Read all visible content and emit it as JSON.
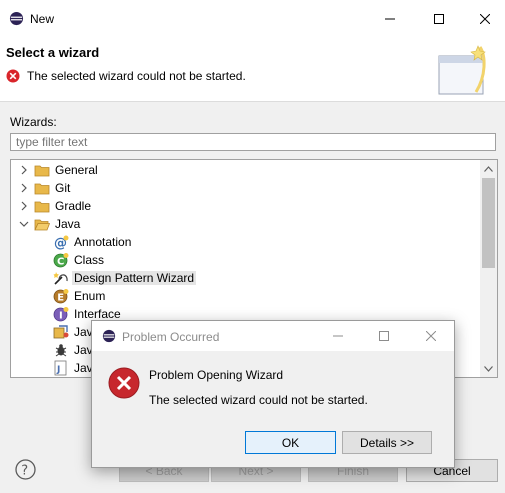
{
  "window": {
    "title": "New",
    "icon": "eclipse-icon"
  },
  "banner": {
    "heading": "Select a wizard",
    "message": "The selected wizard could not be started."
  },
  "wizards_label": "Wizards:",
  "filter": {
    "placeholder": "type filter text",
    "value": ""
  },
  "tree": [
    {
      "label": "General",
      "icon": "folder-icon",
      "expanded": false
    },
    {
      "label": "Git",
      "icon": "folder-icon",
      "expanded": false
    },
    {
      "label": "Gradle",
      "icon": "folder-icon",
      "expanded": false
    },
    {
      "label": "Java",
      "icon": "folder-open-icon",
      "expanded": true
    },
    {
      "label": "Annotation",
      "icon": "annotation-icon"
    },
    {
      "label": "Class",
      "icon": "class-icon"
    },
    {
      "label": "Design Pattern Wizard",
      "icon": "design-pattern-icon",
      "selected": true
    },
    {
      "label": "Enum",
      "icon": "enum-icon"
    },
    {
      "label": "Interface",
      "icon": "interface-icon"
    },
    {
      "label": "Java",
      "icon": "java-project-icon"
    },
    {
      "label": "Java",
      "icon": "java-bug-icon"
    },
    {
      "label": "Java",
      "icon": "java-file-icon"
    }
  ],
  "buttons": {
    "back": "< Back",
    "next": "Next >",
    "finish": "Finish",
    "cancel": "Cancel"
  },
  "dialog": {
    "title": "Problem Occurred",
    "heading": "Problem Opening Wizard",
    "message": "The selected wizard could not be started.",
    "ok": "OK",
    "details": "Details >>"
  },
  "colors": {
    "error": "#d9252b",
    "folder": "#e8b84a",
    "selection": "#e5e5e5"
  }
}
